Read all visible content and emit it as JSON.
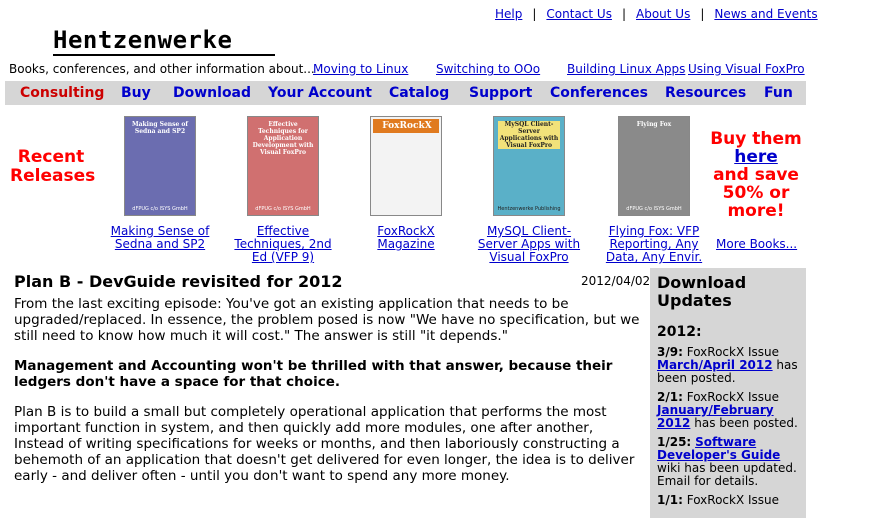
{
  "top_links": [
    "Help",
    "Contact Us",
    "About Us",
    "News and Events"
  ],
  "logo_text": "Hentzenwerke",
  "tagline": "Books, conferences, and other information about...",
  "tag_links": [
    "Moving to Linux",
    "Switching to OOo",
    "Building Linux Apps",
    "Using Visual FoxPro"
  ],
  "nav": [
    "Consulting",
    "Buy",
    "Download",
    "Your Account",
    "Catalog",
    "Support",
    "Conferences",
    "Resources",
    "Fun"
  ],
  "recent_releases": "Recent Releases",
  "books": [
    {
      "link": "Making Sense of Sedna and SP2",
      "cover_title": "Making Sense of Sedna and SP2",
      "cover_pub": "dFPUG c/o ISYS GmbH",
      "cover_color": "#6b6db0"
    },
    {
      "link": "Effective Techniques, 2nd Ed (VFP 9)",
      "cover_title": "Effective Techniques for Application Development with Visual FoxPro",
      "cover_pub": "dFPUG c/o ISYS GmbH",
      "cover_color": "#d07070"
    },
    {
      "link": "FoxRockX Magazine",
      "cover_title": "FoxRockX",
      "cover_pub": "",
      "cover_color": "#f3f3f3"
    },
    {
      "link": "MySQL Client-Server Apps with Visual FoxPro",
      "cover_title": "MySQL Client-Server Applications with Visual FoxPro",
      "cover_pub": "Hentzenwerke Publishing",
      "cover_color": "#5ab0c8"
    },
    {
      "link": "Flying Fox: VFP Reporting, Any Data, Any Envir.",
      "cover_title": "Flying Fox",
      "cover_pub": "dFPUG c/o ISYS GmbH",
      "cover_color": "#8a8a8a"
    }
  ],
  "promo": {
    "buy": "Buy them",
    "here": "here",
    "rest": "and save 50% or more!"
  },
  "more_books": "More Books...",
  "article": {
    "title": "Plan B - DevGuide revisited for 2012",
    "date": "2012/04/02",
    "p1": "From the last exciting episode: You've got an existing application that needs to be upgraded/replaced. In essence, the problem posed is now \"We have no specification, but we still need to know how much it will cost.\" The answer is still \"it depends.\"",
    "p2": "Management and Accounting won't be thrilled with that answer, because their ledgers don't have a space for that choice.",
    "p3": "Plan B is to build a small but completely operational application that performs the most important function in system, and then quickly add more modules, one after another, Instead of writing specifications for weeks or months, and then laboriously constructing a behemoth of an application that doesn't get delivered for even longer, the idea is to deliver early - and deliver often - until you don't want to spend any more money."
  },
  "sidebar": {
    "title": "Download Updates",
    "year": "2012:",
    "updates": [
      {
        "date": "3/9:",
        "pre": "FoxRockX Issue",
        "link": "March/April 2012",
        "post": "has been posted."
      },
      {
        "date": "2/1:",
        "pre": "FoxRockX Issue",
        "link": "January/February 2012",
        "post": "has been posted."
      },
      {
        "date": "1/25:",
        "pre": "",
        "link": "Software Developer's Guide",
        "post": "wiki has been updated. Email for details."
      },
      {
        "date": "1/1:",
        "pre": "FoxRockX Issue",
        "link": "",
        "post": ""
      }
    ]
  }
}
